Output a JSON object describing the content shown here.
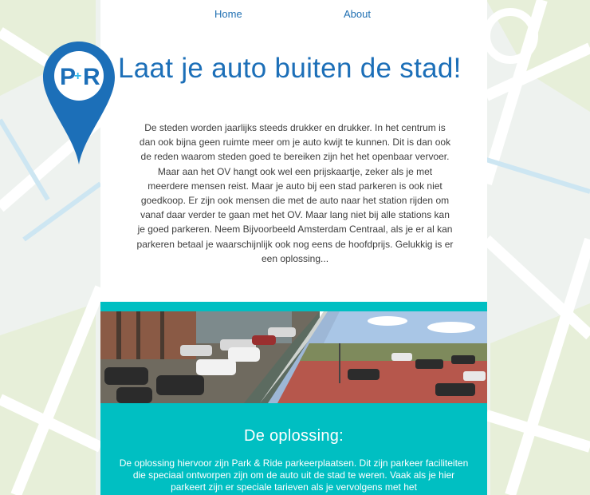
{
  "nav": {
    "items": [
      {
        "label": "Home"
      },
      {
        "label": "About"
      }
    ]
  },
  "logo": {
    "text_p": "P",
    "text_plus": "+",
    "text_r": "R"
  },
  "hero": {
    "title": "Laat je auto buiten de stad!"
  },
  "intro": {
    "text": "De steden worden jaarlijks steeds drukker en drukker. In het centrum is dan ook bijna geen ruimte meer om je auto kwijt te kunnen. Dit is dan ook de reden waarom steden goed te bereiken zijn het het openbaar vervoer. Maar aan het OV hangt ook wel een prijskaartje, zeker als je met meerdere mensen reist. Maar je auto bij een stad parkeren is ook niet goedkoop. Er zijn ook mensen die met de auto naar het station rijden om vanaf daar verder te gaan met het OV. Maar lang niet bij alle stations kan je goed parkeren. Neem Bijvoorbeeld Amsterdam Centraal, als je er al kan parkeren betaal je waarschijnlijk ook nog eens de hoofdprijs. Gelukkig is er een oplossing..."
  },
  "solution": {
    "heading": "De oplossing:",
    "text": "De oplossing hiervoor zijn Park & Ride parkeerplaatsen. Dit zijn parkeer faciliteiten die speciaal ontworpen zijn om de auto uit de stad te weren. Vaak als je hier parkeert zijn er speciale tarieven als je vervolgens met het"
  },
  "colors": {
    "brand_blue": "#1c6fb8",
    "teal": "#00bfc2"
  },
  "icons": {
    "logo": "park-and-ride-map-pin-icon"
  }
}
